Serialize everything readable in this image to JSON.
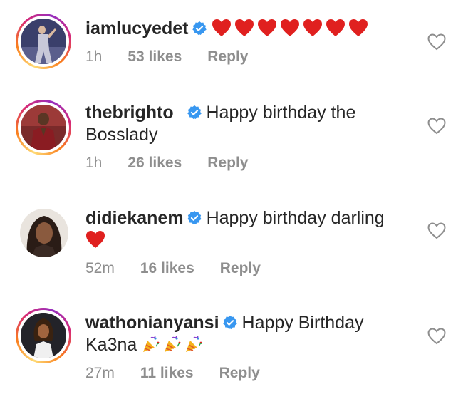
{
  "comments": [
    {
      "username": "iamlucyedet",
      "text": "",
      "emoji": "heart-emoji x7",
      "time": "1h",
      "likes": "53 likes",
      "reply": "Reply"
    },
    {
      "username": "thebrighto_",
      "text": "Happy birthday the Bosslady",
      "time": "1h",
      "likes": "26 likes",
      "reply": "Reply"
    },
    {
      "username": "didiekanem",
      "text": "Happy birthday darling",
      "emoji": "heart-emoji",
      "time": "52m",
      "likes": "16 likes",
      "reply": "Reply"
    },
    {
      "username": "wathonianyansi",
      "text": "Happy Birthday Ka3na",
      "emoji": "party-popper-emoji x3",
      "time": "27m",
      "likes": "11 likes",
      "reply": "Reply"
    }
  ],
  "colors": {
    "text": "#262626",
    "meta": "#8e8e8e",
    "verified": "#3897f0",
    "heart": "#e0201f"
  }
}
